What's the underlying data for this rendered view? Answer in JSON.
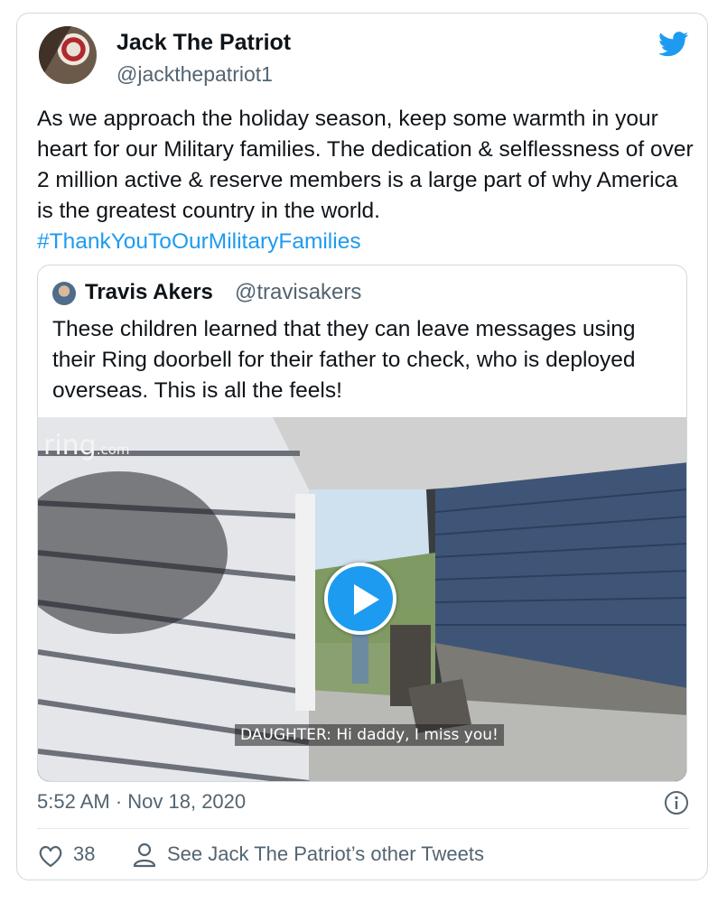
{
  "tweet": {
    "author_name": "Jack The Patriot",
    "author_handle": "@jackthepatriot1",
    "text_before": "As we approach the holiday season, keep some warmth in your heart for our Military families. The dedication & selflessness of over 2 million active & reserve members is a large part of why America is the greatest country in the world. ",
    "hashtag": "#ThankYouToOurMilitaryFamilies",
    "timestamp": "5:52 AM · Nov 18, 2020",
    "like_count": "38",
    "see_more": "See Jack The Patriot’s other Tweets"
  },
  "quoted": {
    "author_name": "Travis Akers",
    "author_handle": "@travisakers",
    "text": "These children learned that they can leave messages using their Ring doorbell for their father to check, who is deployed overseas. This is all the feels!",
    "video": {
      "logo_main": "ring",
      "logo_suffix": ".com",
      "caption": "DAUGHTER: Hi daddy, I miss you!"
    }
  },
  "icons": {
    "twitter_logo": "twitter-bird-icon",
    "play": "play-icon",
    "info": "info-icon",
    "like": "heart-icon",
    "profile": "person-icon"
  },
  "colors": {
    "accent": "#1d9bf0",
    "text": "#0f1419",
    "secondary": "#536471",
    "border": "#cfd9de"
  }
}
